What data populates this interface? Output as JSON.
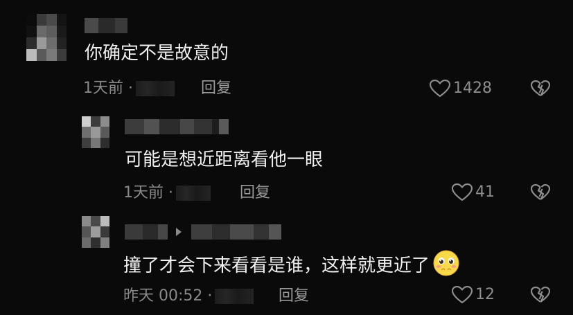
{
  "comments": [
    {
      "text": "你确定不是故意的",
      "timestamp": "1天前 · ",
      "reply_label": "回复",
      "like_count": "1428",
      "icons": {
        "like": "heart-outline-icon",
        "dislike": "broken-heart-icon"
      }
    },
    {
      "text": "可能是想近距离看他一眼",
      "timestamp": "1天前 · ",
      "reply_label": "回复",
      "like_count": "41",
      "icons": {
        "like": "heart-outline-icon",
        "dislike": "broken-heart-icon"
      }
    },
    {
      "text": "撞了才会下来看看是谁，这样就更近了",
      "timestamp": "昨天 00:52 · ",
      "reply_label": "回复",
      "like_count": "12",
      "emoji": "shy-face-emoji",
      "icons": {
        "like": "heart-outline-icon",
        "dislike": "broken-heart-icon",
        "reply_to": "reply-arrow-icon"
      }
    }
  ],
  "colors": {
    "background": "#0a0a0a",
    "text": "#f0f0f0",
    "meta": "#8a8a8a"
  }
}
